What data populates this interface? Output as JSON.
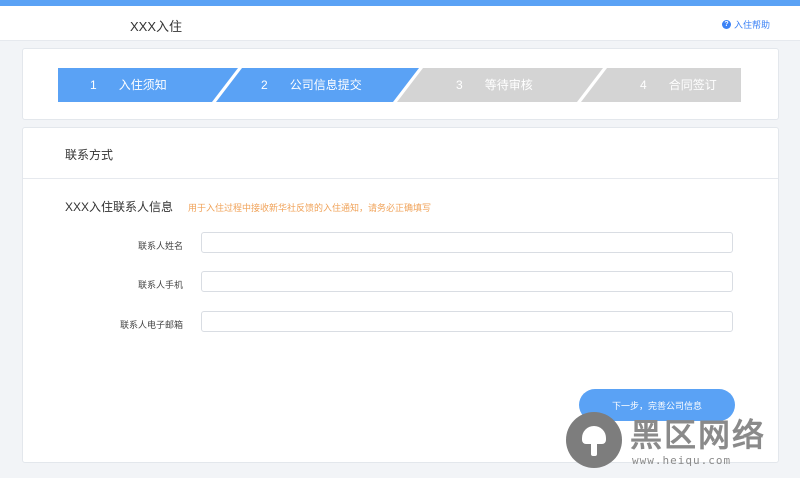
{
  "header": {
    "brand": "XXX入住",
    "help_label": "入住帮助",
    "help_icon": "question-circle-icon"
  },
  "steps": [
    {
      "num": "1",
      "label": "入住须知",
      "state": "completed"
    },
    {
      "num": "2",
      "label": "公司信息提交",
      "state": "active"
    },
    {
      "num": "3",
      "label": "等待审核",
      "state": "pending"
    },
    {
      "num": "4",
      "label": "合同签订",
      "state": "pending"
    }
  ],
  "colors": {
    "accent": "#5aa2f5",
    "step_inactive": "#d4d4d4",
    "hint": "#f0a35a"
  },
  "form": {
    "section_title": "联系方式",
    "subsection_title": "XXX入住联系人信息",
    "subsection_hint": "用于入住过程中接收新华社反馈的入住通知，请务必正确填写",
    "fields": [
      {
        "label": "联系人姓名",
        "value": "",
        "placeholder": ""
      },
      {
        "label": "联系人手机",
        "value": "",
        "placeholder": ""
      },
      {
        "label": "联系人电子邮箱",
        "value": "",
        "placeholder": ""
      }
    ],
    "next_button": "下一步，完善公司信息"
  },
  "watermark": {
    "title": "黑区网络",
    "url": "www.heiqu.com"
  }
}
